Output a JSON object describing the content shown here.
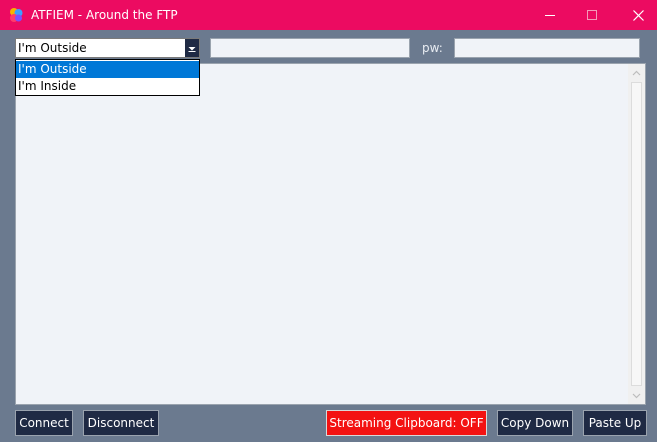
{
  "window": {
    "title": "ATFIEM - Around the FTP",
    "colors": {
      "titlebar": "#ec0b61",
      "background": "#6b7a8f",
      "button": "#1f2a44",
      "streaming_off": "#f31212",
      "selected_option": "#0078d7"
    }
  },
  "location_select": {
    "value": "I'm Outside",
    "options": [
      "I'm Outside",
      "I'm Inside"
    ],
    "selected_option": "I'm Outside"
  },
  "server_field": {
    "value": ""
  },
  "password": {
    "label": "pw:",
    "value": ""
  },
  "output": {
    "text": ""
  },
  "toolbar": {
    "connect": "Connect",
    "disconnect": "Disconnect",
    "streaming": "Streaming Clipboard: OFF",
    "copy_down": "Copy Down",
    "paste_up": "Paste Up"
  },
  "icons": [
    "app-logo-icon",
    "minimize-icon",
    "maximize-icon",
    "close-icon",
    "chevron-down-icon",
    "scroll-up-icon",
    "scroll-down-icon"
  ]
}
